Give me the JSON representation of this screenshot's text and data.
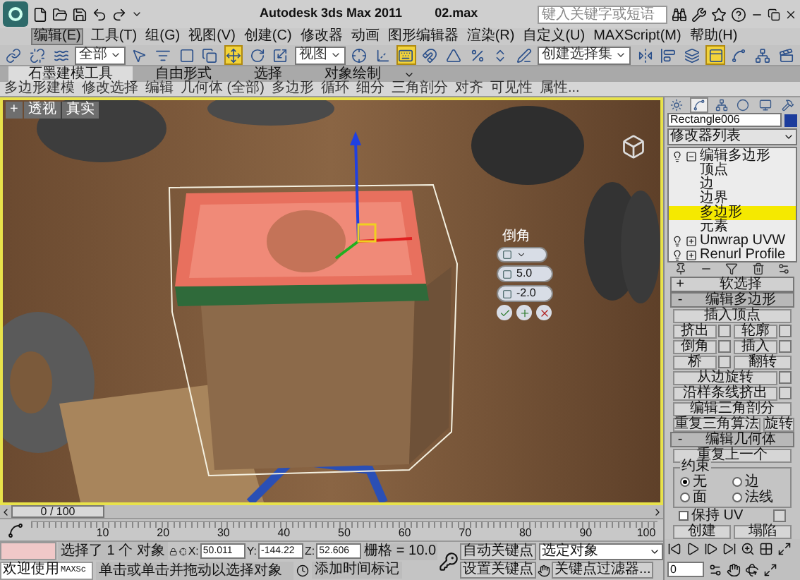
{
  "title_bar": {
    "title": "Autodesk 3ds Max  2011",
    "file": "02.max",
    "search": {
      "placeholder": "键入关键字或短语"
    }
  },
  "menu": [
    {
      "label": "编辑(E)",
      "selected": true
    },
    {
      "label": "工具(T)",
      "selected": false
    },
    {
      "label": "组(G)",
      "selected": false
    },
    {
      "label": "视图(V)",
      "selected": false
    },
    {
      "label": "创建(C)",
      "selected": false
    },
    {
      "label": "修改器",
      "selected": false
    },
    {
      "label": "动画",
      "selected": false
    },
    {
      "label": "图形编辑器",
      "selected": false
    },
    {
      "label": "渲染(R)",
      "selected": false
    },
    {
      "label": "自定义(U)",
      "selected": false
    },
    {
      "label": "MAXScript(M)",
      "selected": false
    },
    {
      "label": "帮助(H)",
      "selected": false
    }
  ],
  "toolbar": [
    {
      "kind": "button",
      "selected": false
    },
    {
      "kind": "button",
      "selected": false
    },
    {
      "kind": "button",
      "selected": false
    },
    {
      "kind": "dropdown",
      "value": "全部"
    },
    {
      "kind": "button",
      "selected": false
    },
    {
      "kind": "button",
      "selected": false
    },
    {
      "kind": "button",
      "selected": false
    },
    {
      "kind": "button",
      "selected": false
    },
    {
      "kind": "button",
      "selected": true
    },
    {
      "kind": "button",
      "selected": false
    },
    {
      "kind": "button",
      "selected": false
    },
    {
      "kind": "dropdown",
      "value": "视图"
    },
    {
      "kind": "button",
      "selected": false
    },
    {
      "kind": "button",
      "selected": false
    },
    {
      "kind": "button",
      "selected": true
    },
    {
      "kind": "button",
      "selected": false
    },
    {
      "kind": "button",
      "selected": false
    },
    {
      "kind": "button",
      "selected": false
    },
    {
      "kind": "button",
      "selected": false
    },
    {
      "kind": "button",
      "selected": false
    },
    {
      "kind": "dropdown",
      "value": "创建选择集"
    },
    {
      "kind": "button",
      "selected": false
    },
    {
      "kind": "button",
      "selected": false
    },
    {
      "kind": "button",
      "selected": false
    },
    {
      "kind": "button",
      "selected": true
    },
    {
      "kind": "button",
      "selected": false
    },
    {
      "kind": "button",
      "selected": false
    },
    {
      "kind": "button",
      "selected": false
    }
  ],
  "ribbon": {
    "tabs": [
      {
        "label": "石墨建模工具",
        "selected": true
      },
      {
        "label": "自由形式",
        "selected": false
      },
      {
        "label": "选择",
        "selected": false
      },
      {
        "label": "对象绘制",
        "selected": false
      }
    ],
    "panels": [
      "多边形建模",
      "修改选择",
      "编辑",
      "几何体 (全部)",
      "多边形",
      "循环",
      "细分",
      "三角剖分",
      "对齐",
      "可见性",
      "属性..."
    ]
  },
  "viewport": {
    "labels": [
      "+",
      "透视",
      "真实"
    ],
    "active": true,
    "caddy": {
      "title": "倒角",
      "fields": [
        "5.0",
        "-2.0"
      ]
    }
  },
  "time_slider": {
    "position": "0 / 100",
    "level": 0
  },
  "ruler": {
    "labels": [
      "10",
      "20",
      "30",
      "40",
      "50",
      "60",
      "70",
      "80",
      "90",
      "100"
    ]
  },
  "status": {
    "welcome": "欢迎使用",
    "listener_prefix": "MAXSc",
    "selection": "选择了 1 个 对象",
    "prompt": "单击或单击并拖动以选择对象",
    "coords": [
      {
        "axis": "X:",
        "value": "50.011"
      },
      {
        "axis": "Y:",
        "value": "-144.22"
      },
      {
        "axis": "Z:",
        "value": "52.606"
      }
    ],
    "grid": "栅格 = 10.0",
    "time_tag": "添加时间标记",
    "auto_key": "自动关键点",
    "key_dropdown": "选定对象",
    "set_key": "设置关键点",
    "key_filters": "关键点过滤器...",
    "frame": "0"
  },
  "command_panel": {
    "tabs": [
      {
        "selected": false
      },
      {
        "selected": true
      },
      {
        "selected": false
      },
      {
        "selected": false
      },
      {
        "selected": false
      },
      {
        "selected": false
      }
    ],
    "object_name": "Rectangle006",
    "modifier_list": "修改器列表",
    "stack": [
      {
        "label": "编辑多边形",
        "expanded": true,
        "selected": false,
        "children": [
          {
            "label": "顶点",
            "selected": false
          },
          {
            "label": "边",
            "selected": false
          },
          {
            "label": "边界",
            "selected": false
          },
          {
            "label": "多边形",
            "selected": true
          },
          {
            "label": "元素",
            "selected": false
          }
        ]
      },
      {
        "label": "Unwrap UVW",
        "expanded": false,
        "selected": false
      },
      {
        "label": "Renurl Profile",
        "expanded": false,
        "selected": false
      }
    ],
    "rollouts": [
      {
        "sign": "+",
        "title": "软选择",
        "expanded": false
      },
      {
        "sign": "-",
        "title": "编辑多边形",
        "expanded": true,
        "rows": [
          [
            {
              "label": "插入顶点",
              "settings": false
            }
          ],
          [
            {
              "label": "挤出",
              "settings": true
            },
            {
              "label": "轮廓",
              "settings": true
            }
          ],
          [
            {
              "label": "倒角",
              "settings": true
            },
            {
              "label": "插入",
              "settings": true
            }
          ],
          [
            {
              "label": "桥",
              "settings": true
            },
            {
              "label": "翻转",
              "settings": false
            }
          ],
          [
            {
              "label": "从边旋转",
              "settings": true
            }
          ],
          [
            {
              "label": "沿样条线挤出",
              "settings": true
            }
          ],
          [
            {
              "label": "编辑三角剖分",
              "settings": false
            }
          ],
          [
            {
              "label": "重复三角算法",
              "settings": false
            },
            {
              "label": "旋转",
              "settings": false
            }
          ]
        ]
      },
      {
        "sign": "-",
        "title": "编辑几何体",
        "expanded": true,
        "rows": [
          [
            {
              "label": "重复上一个",
              "settings": false
            }
          ]
        ],
        "constraints": {
          "title": "约束",
          "options": [
            {
              "label": "无",
              "selected": true
            },
            {
              "label": "边",
              "selected": false
            },
            {
              "label": "面",
              "selected": false
            },
            {
              "label": "法线",
              "selected": false
            }
          ]
        },
        "checkbox": {
          "label": "保持 UV",
          "checked": false
        },
        "bottom_rows": [
          [
            {
              "label": "创建",
              "settings": false
            },
            {
              "label": "塌陷",
              "settings": false
            }
          ]
        ]
      }
    ]
  }
}
